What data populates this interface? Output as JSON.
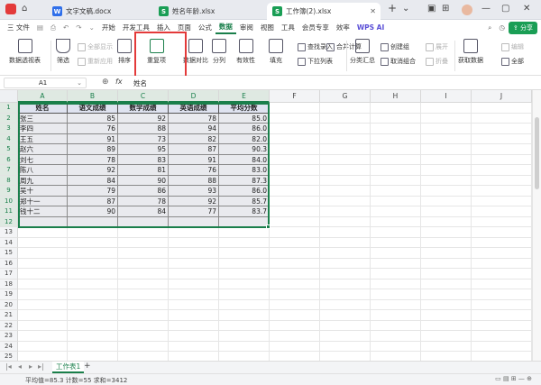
{
  "titlebar": {
    "tabs": [
      {
        "label": "文字文稿.docx",
        "icon": "W",
        "icon_color": "#2f6fea"
      },
      {
        "label": "姓名年龄.xlsx",
        "icon": "S",
        "icon_color": "#1a9e55"
      },
      {
        "label": "工作簿(2).xlsx",
        "icon": "S",
        "icon_color": "#1a9e55"
      }
    ],
    "add_tab": "+",
    "share_label": "分享"
  },
  "menubar": {
    "file_label": "三 文件",
    "items": [
      "开始",
      "开发工具",
      "插入",
      "页面",
      "公式",
      "数据",
      "审阅",
      "视图",
      "工具",
      "会员专享",
      "效率"
    ],
    "active_index": 5,
    "wps_ai": "WPS AI"
  },
  "ribbon": {
    "pivot": "数据透视表",
    "filter": "筛选",
    "show_all": "全部显示",
    "reapply": "重新应用",
    "sort": "排序",
    "duplicates": "重复项",
    "compare": "数据对比",
    "split": "分列",
    "validity": "有效性",
    "fill": "填充",
    "lookup": "查找录入",
    "merge_calc": "合并计算",
    "dropdown": "下拉列表",
    "subtotal": "分类汇总",
    "create_group": "创建组",
    "ungroup": "取消组合",
    "expand": "展开",
    "collapse": "折叠",
    "get_data": "获取数据",
    "edit": "编辑",
    "refresh_all": "全部"
  },
  "formulabar": {
    "cell_ref": "A1",
    "fx": "fx",
    "value": "姓名"
  },
  "sheet": {
    "columns": [
      "A",
      "B",
      "C",
      "D",
      "E",
      "F",
      "G",
      "H",
      "I",
      "J"
    ],
    "rows": [
      "1",
      "2",
      "3",
      "4",
      "5",
      "6",
      "7",
      "8",
      "9",
      "10",
      "11",
      "12",
      "13",
      "14",
      "15",
      "16",
      "17",
      "18",
      "19",
      "20",
      "21",
      "22",
      "23",
      "24",
      "25"
    ],
    "headers": [
      "姓名",
      "语文成绩",
      "数学成绩",
      "英语成绩",
      "平均分数"
    ],
    "data": [
      [
        "张三",
        "85",
        "92",
        "78",
        "85.0"
      ],
      [
        "李四",
        "76",
        "88",
        "94",
        "86.0"
      ],
      [
        "王五",
        "91",
        "73",
        "82",
        "82.0"
      ],
      [
        "赵六",
        "89",
        "95",
        "87",
        "90.3"
      ],
      [
        "刘七",
        "78",
        "83",
        "91",
        "84.0"
      ],
      [
        "陈八",
        "92",
        "81",
        "76",
        "83.0"
      ],
      [
        "周九",
        "84",
        "90",
        "88",
        "87.3"
      ],
      [
        "吴十",
        "79",
        "86",
        "93",
        "86.0"
      ],
      [
        "郑十一",
        "87",
        "78",
        "92",
        "85.7"
      ],
      [
        "钱十二",
        "90",
        "84",
        "77",
        "83.7"
      ]
    ]
  },
  "sheetbar": {
    "tab_label": "工作表1",
    "add": "+"
  },
  "statusbar": {
    "text": "平均值=85.3  计数=55  求和=3412"
  },
  "colors": {
    "accent": "#1a7f4b",
    "highlight_box": "#e33a3a",
    "header_fill": "#dfe3f0"
  }
}
